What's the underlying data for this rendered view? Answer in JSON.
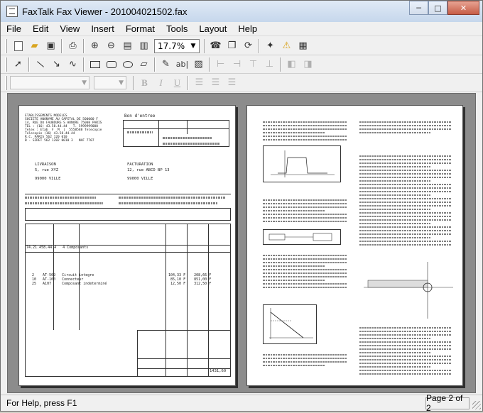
{
  "window": {
    "title": "FaxTalk Fax Viewer - 201004021502.fax"
  },
  "window_controls": {
    "minimize": "─",
    "maximize": "□",
    "close": "✕"
  },
  "menu": [
    "File",
    "Edit",
    "View",
    "Insert",
    "Format",
    "Tools",
    "Layout",
    "Help"
  ],
  "toolbar": {
    "zoom_value": "17.7%"
  },
  "format_bar": {
    "bold": "B",
    "italic": "I",
    "underline": "U",
    "text_tool": "ab|"
  },
  "page1": {
    "header_left": "ETABLISSEMENTS MODELES\nSOCIETE ANONYME AU CAPITAL DE 500000 F\n14, RUE DU FAUBOURG S HONORE 75008 PARIS\nTEL : (16) 43.58.44.44   T. 5999999000\nTelex : Etab  F  M  |  5558588 Telecopie\nTelecopie (16) 43.58.44.44\nR.C. PARIS 562 120 010\nB - SIRET 562 1202 0010 3   NAF 7707",
    "invoice_title": "Bon d'entree",
    "ship_label": "LIVRAISON",
    "ship_address": "5, rue XYZ\n\n99000 VILLE",
    "bill_label": "FACTURATION",
    "bill_address": "12, rue ABCD BP 13\n\n99000 VILLE",
    "item_row": "74.21.458.44.4   4 Composants",
    "items": "2    AT-509   Circuit integre\n10   AT-100   Connecteur\n25   A107     Composant indeterminé",
    "amounts": "104,33 F    208,66 F\n 85,10 F    851,00 F\n 12,50 F    312,50 F",
    "total": "1431,60"
  },
  "status": {
    "help": "For Help, press F1",
    "page": "Page 2 of 2"
  }
}
